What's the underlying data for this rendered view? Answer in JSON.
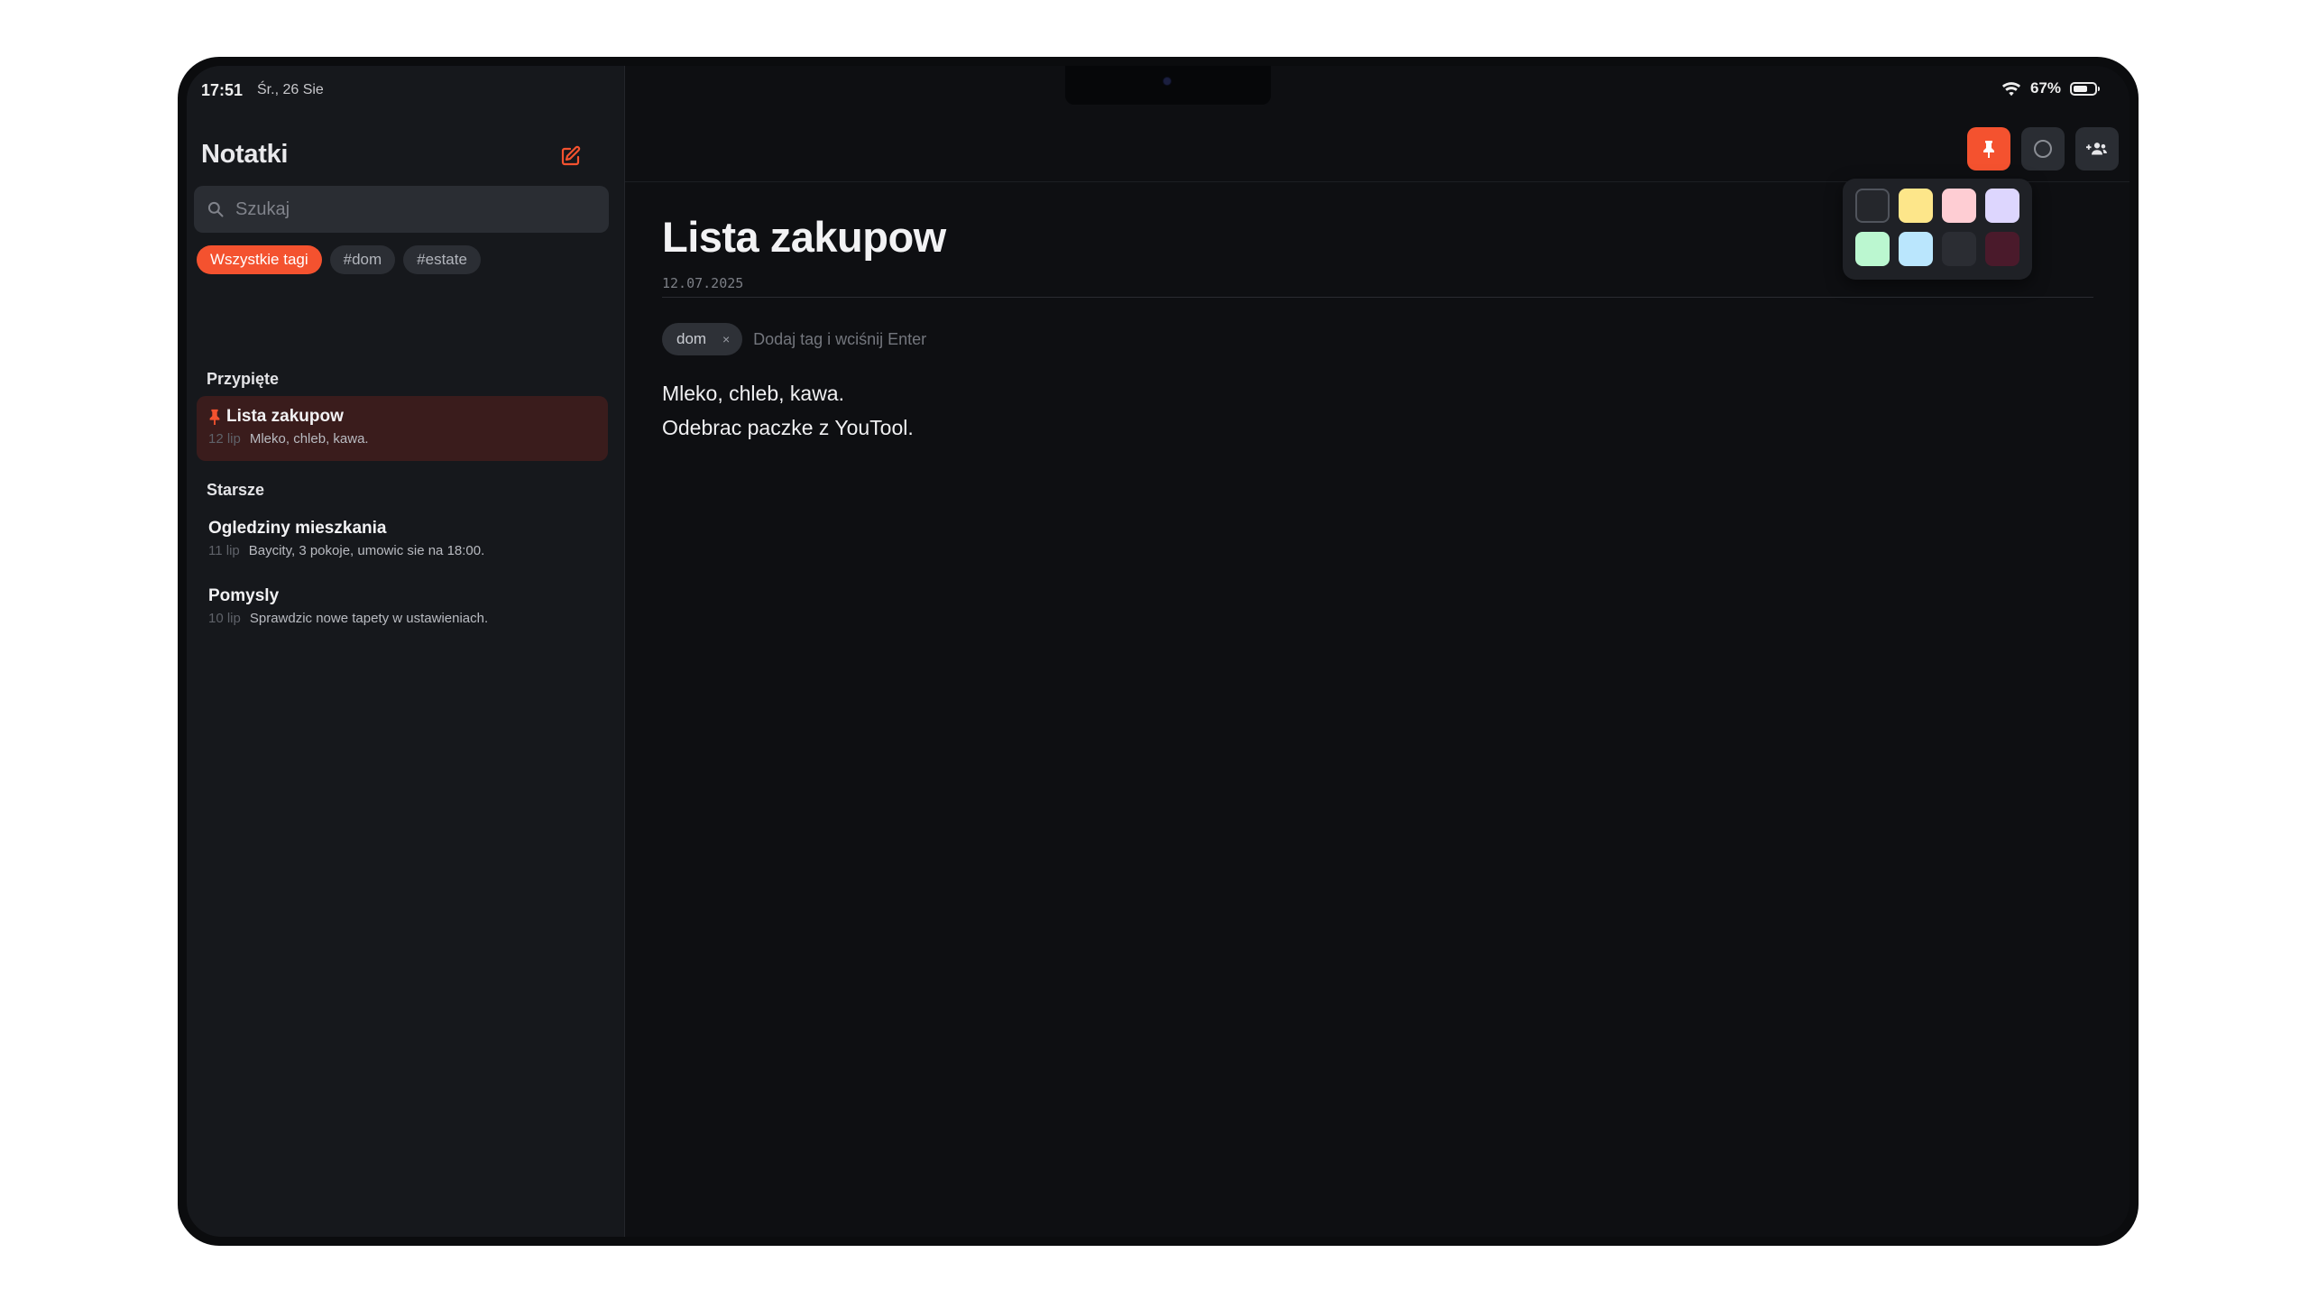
{
  "status": {
    "time": "17:51",
    "date": "Śr., 26 Sie",
    "battery": "67%",
    "battery_level": 0.67
  },
  "sidebar": {
    "title": "Notatki",
    "search_placeholder": "Szukaj",
    "tags": [
      "Wszystkie tagi",
      "#dom",
      "#estate"
    ],
    "pinned_label": "Przypięte",
    "older_label": "Starsze",
    "pinned_notes": [
      {
        "title": "Lista zakupow",
        "date": "12 lip",
        "preview": "Mleko, chleb, kawa."
      }
    ],
    "older_notes": [
      {
        "title": "Ogledziny mieszkania",
        "date": "11 lip",
        "preview": "Baycity, 3 pokoje, umowic sie na 18:00."
      },
      {
        "title": "Pomysly",
        "date": "10 lip",
        "preview": "Sprawdzic nowe tapety w ustawieniach."
      }
    ]
  },
  "note": {
    "title": "Lista zakupow",
    "date": "12.07.2025",
    "tag": "dom",
    "tag_remove": "×",
    "tag_input_placeholder": "Dodaj tag i wciśnij Enter",
    "lines": [
      "Mleko, chleb, kawa.",
      "Odebrac paczke z YouTool."
    ]
  },
  "palette": {
    "colors": [
      "#25272c",
      "#fde68a",
      "#fecdd3",
      "#ddd6fe",
      "#bbf7d0",
      "#bae6fd",
      "#2b2d33",
      "#4a1a2b"
    ]
  },
  "colors": {
    "accent": "#f4522f"
  }
}
